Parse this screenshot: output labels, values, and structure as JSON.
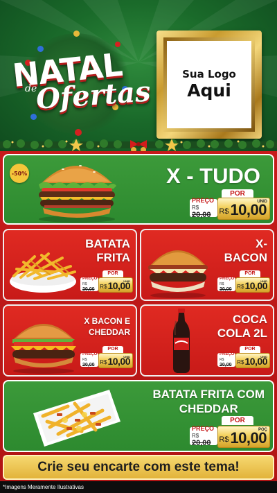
{
  "header": {
    "logo_line1": "NATAL",
    "logo_de": "de",
    "logo_line2": "Ofertas",
    "frame_small": "Sua Logo",
    "frame_big": "Aqui"
  },
  "products": [
    {
      "name": "X - TUDO",
      "badge": "-50%",
      "por_label": "POR",
      "preco_label": "PREÇO",
      "old_currency": "R$",
      "old_price": "20,00",
      "currency": "R$",
      "price": "10,00",
      "unit": "UNID"
    },
    {
      "name_line1": "BATATA",
      "name_line2": "FRITA",
      "por_label": "POR",
      "preco_label": "PREÇO",
      "old_currency": "R$",
      "old_price": "20,00",
      "currency": "R$",
      "price": "10,00",
      "unit": "UNID"
    },
    {
      "name_line1": "X-",
      "name_line2": "BACON",
      "por_label": "POR",
      "preco_label": "PREÇO",
      "old_currency": "R$",
      "old_price": "20,00",
      "currency": "R$",
      "price": "10,00",
      "unit": "UNID"
    },
    {
      "name_line1": "X BACON E",
      "name_line2": "CHEDDAR",
      "por_label": "POR",
      "preco_label": "PREÇO",
      "old_currency": "R$",
      "old_price": "20,00",
      "currency": "R$",
      "price": "10,00",
      "unit": "UNID"
    },
    {
      "name_line1": "COCA",
      "name_line2": "COLA 2L",
      "por_label": "POR",
      "preco_label": "PREÇO",
      "old_currency": "R$",
      "old_price": "20,00",
      "currency": "R$",
      "price": "10,00",
      "unit": "UNID"
    },
    {
      "name_line1": "BATATA FRITA COM",
      "name_line2": "CHEDDAR",
      "por_label": "POR",
      "preco_label": "PREÇO",
      "old_currency": "R$",
      "old_price": "20,00",
      "currency": "R$",
      "price": "10,00",
      "unit": "POÇ"
    }
  ],
  "cta_text": "Crie seu encarte com este tema!",
  "footer_text": "*Imagens Meramente Ilustrativas",
  "colors": {
    "green": "#2d8a2f",
    "red": "#c81a18",
    "gold": "#f2cf5a"
  }
}
